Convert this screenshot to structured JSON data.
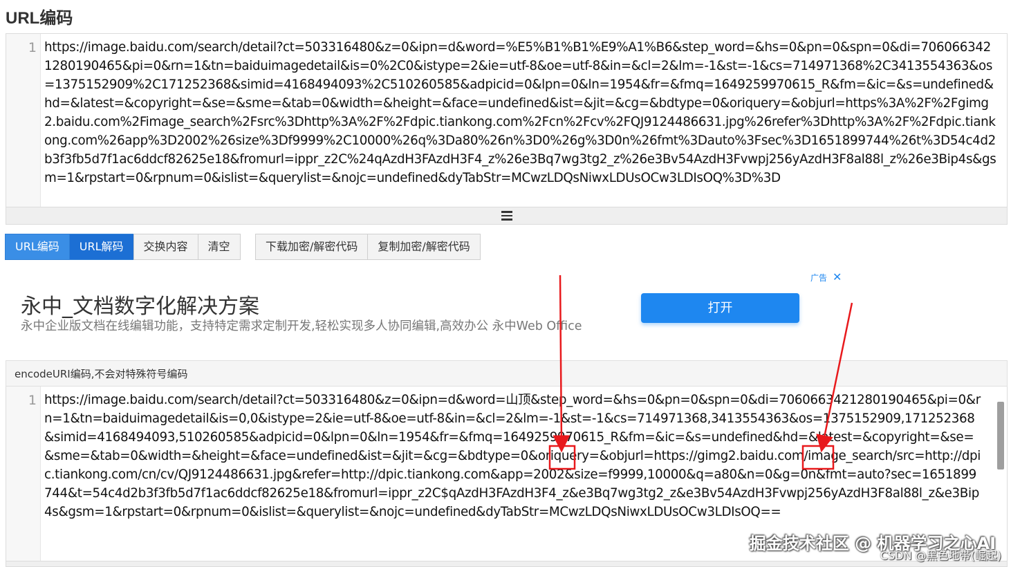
{
  "page": {
    "title": "URL编码"
  },
  "editor_top": {
    "line_number": "1",
    "content": "https://image.baidu.com/search/detail?ct=503316480&z=0&ipn=d&word=%E5%B1%B1%E9%A1%B6&step_word=&hs=0&pn=0&spn=0&di=7060663421280190465&pi=0&rn=1&tn=baiduimagedetail&is=0%2C0&istype=2&ie=utf-8&oe=utf-8&in=&cl=2&lm=-1&st=-1&cs=714971368%2C3413554363&os=1375152909%2C171252368&simid=4168494093%2C510260585&adpicid=0&lpn=0&ln=1954&fr=&fmq=1649259970615_R&fm=&ic=&s=undefined&hd=&latest=&copyright=&se=&sme=&tab=0&width=&height=&face=undefined&ist=&jit=&cg=&bdtype=0&oriquery=&objurl=https%3A%2F%2Fgimg2.baidu.com%2Fimage_search%2Fsrc%3Dhttp%3A%2F%2Fdpic.tiankong.com%2Fcn%2Fcv%2FQJ9124486631.jpg%26refer%3Dhttp%3A%2F%2Fdpic.tiankong.com%26app%3D2002%26size%3Df9999%2C10000%26q%3Da80%26n%3D0%26g%3D0n%26fmt%3Dauto%3Fsec%3D1651899744%26t%3D54c4d2b3f3fb5d7f1ac6ddcf82625e18&fromurl=ippr_z2C%24qAzdH3FAzdH3F4_z%26e3Bq7wg3tg2_z%26e3Bv54AzdH3Fvwpj256yAzdH3F8al88l_z%26e3Bip4s&gsm=1&rpstart=0&rpnum=0&islist=&querylist=&nojc=undefined&dyTabStr=MCwzLDQsNiwxLDUsOCw3LDIsOQ%3D%3D"
  },
  "toolbar": {
    "encode": "URL编码",
    "decode": "URL解码",
    "swap": "交换内容",
    "clear": "清空",
    "download_code": "下载加密/解密代码",
    "copy_code": "复制加密/解密代码"
  },
  "ad": {
    "title": "永中_文档数字化解决方案",
    "description": "永中企业版文档在线编辑功能，支持特定需求定制开发,轻松实现多人协同编辑,高效办公 永中Web Office",
    "open_button": "打开",
    "label": "广告",
    "close": "✕"
  },
  "result": {
    "header": "encodeURI编码,不会对特殊符号编码"
  },
  "editor_bottom": {
    "line_number": "1",
    "content": "https://image.baidu.com/search/detail?ct=503316480&z=0&ipn=d&word=山顶&step_word=&hs=0&pn=0&spn=0&di=7060663421280190465&pi=0&rn=1&tn=baiduimagedetail&is=0,0&istype=2&ie=utf-8&oe=utf-8&in=&cl=2&lm=-1&st=-1&cs=714971368,3413554363&os=1375152909,171252368&simid=4168494093,510260585&adpicid=0&lpn=0&ln=1954&fr=&fmq=1649259970615_R&fm=&ic=&s=undefined&hd=&latest=&copyright=&se=&sme=&tab=0&width=&height=&face=undefined&ist=&jit=&cg=&bdtype=0&oriquery=&objurl=https://gimg2.baidu.com/image_search/src=http://dpic.tiankong.com/cn/cv/QJ9124486631.jpg&refer=http://dpic.tiankong.com&app=2002&size=f9999,10000&q=a80&n=0&g=0n&fmt=auto?sec=1651899744&t=54c4d2b3f3fb5d7f1ac6ddcf82625e18&fromurl=ippr_z2C$qAzdH3FAzdH3F4_z&e3Bq7wg3tg2_z&e3Bv54AzdH3Fvwpj256yAzdH3F8al88l_z&e3Bip4s&gsm=1&rpstart=0&rpnum=0&islist=&querylist=&nojc=undefined&dyTabStr=MCwzLDQsNiwxLDUsOCw3LDIsOQ=="
  },
  "watermark": {
    "main": "掘金技术社区 @ 机器学习之心AI",
    "sub": "CSDN @黑色地带(崛起)"
  },
  "colors": {
    "primary": "#3a8ee6",
    "ad_button": "#1e87f0",
    "annotation": "#e8191c"
  }
}
